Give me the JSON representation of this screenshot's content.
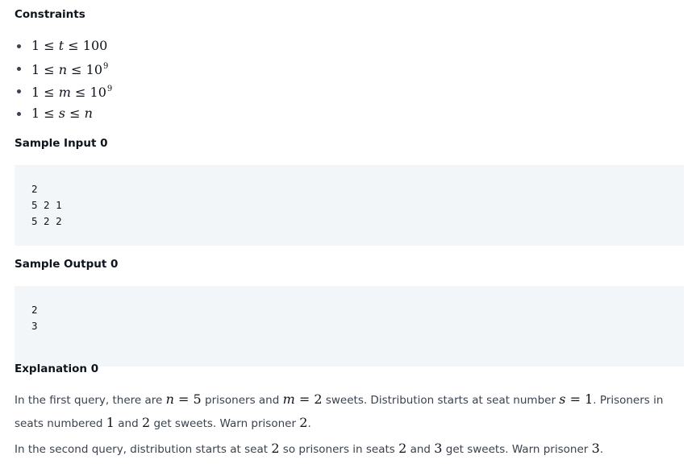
{
  "constraints": {
    "heading": "Constraints",
    "items": [
      {
        "lhs": "1 ≤ ",
        "var": "t",
        "rhs": " ≤ 100",
        "sup": ""
      },
      {
        "lhs": "1 ≤ ",
        "var": "n",
        "rhs": " ≤ 10",
        "sup": "9"
      },
      {
        "lhs": "1 ≤ ",
        "var": "m",
        "rhs": " ≤ 10",
        "sup": "9"
      },
      {
        "lhs": "1 ≤ ",
        "var": "s",
        "rhs": " ≤ ",
        "var2": "n"
      }
    ]
  },
  "sample_input": {
    "heading": "Sample Input 0",
    "lines": [
      "2",
      "5 2 1",
      "5 2 2"
    ]
  },
  "sample_output": {
    "heading": "Sample Output 0",
    "lines": [
      "2",
      "3"
    ]
  },
  "explanation": {
    "heading": "Explanation 0",
    "p1": {
      "t1": "In the first query, there are ",
      "m1v": "n",
      "m1r": " = 5",
      "t2": " prisoners and ",
      "m2v": "m",
      "m2r": " = 2",
      "t3": " sweets. Distribution starts at seat number ",
      "m3v": "s",
      "m3r": " = 1",
      "t4": ". Prisoners in seats numbered ",
      "m4": "1",
      "t5": " and ",
      "m5": "2",
      "t6": " get sweets. Warn prisoner ",
      "m6": "2",
      "t7": "."
    },
    "p2": {
      "t1": "In the second query, distribution starts at seat ",
      "m1": "2",
      "t2": " so prisoners in seats ",
      "m2": "2",
      "t3": " and ",
      "m3": "3",
      "t4": " get sweets. Warn prisoner ",
      "m4": "3",
      "t5": "."
    }
  }
}
